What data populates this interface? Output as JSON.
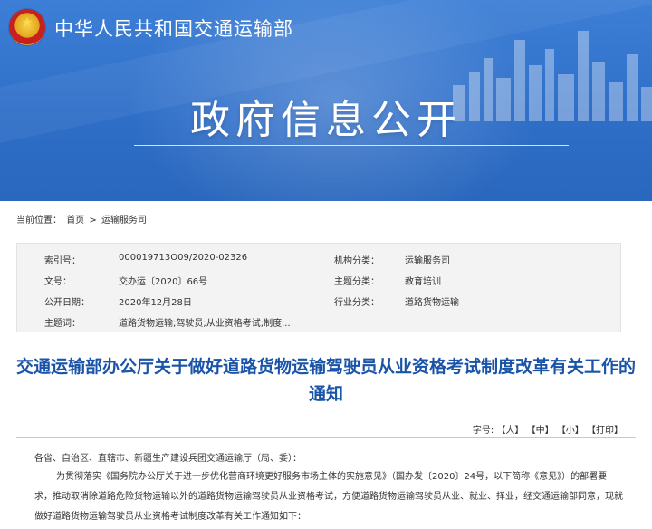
{
  "header": {
    "ministry_name": "中华人民共和国交通运输部",
    "section_title": "政府信息公开"
  },
  "breadcrumb": {
    "label": "当前位置：",
    "home": "首页",
    "separator": ">",
    "current": "运输服务司"
  },
  "info": {
    "rows": [
      {
        "label1": "索引号：",
        "value1": "000019713O09/2020-02326",
        "label2": "机构分类：",
        "value2": "运输服务司"
      },
      {
        "label1": "文号：",
        "value1": "交办运〔2020〕66号",
        "label2": "主题分类：",
        "value2": "教育培训"
      },
      {
        "label1": "公开日期：",
        "value1": "2020年12月28日",
        "label2": "行业分类：",
        "value2": "道路货物运输"
      },
      {
        "label1": "主题词：",
        "value1": "道路货物运输;驾驶员;从业资格考试;制度...",
        "label2": "",
        "value2": ""
      }
    ]
  },
  "article": {
    "title": "交通运输部办公厅关于做好道路货物运输驾驶员从业资格考试制度改革有关工作的通知",
    "font_size_label": "字号:",
    "font_large": "【大】",
    "font_medium": "【中】",
    "font_small": "【小】",
    "print": "【打印】",
    "para1": "各省、自治区、直辖市、新疆生产建设兵团交通运输厅（局、委）：",
    "para2": "为贯彻落实《国务院办公厅关于进一步优化营商环境更好服务市场主体的实施意见》（国办发〔2020〕24号，以下简称《意见》）的部署要求，推动取消除道路危险货物运输以外的道路货物运输驾驶员从业资格考试，方便道路货物运输驾驶员从业、就业、择业，经交通运输部同意，现就做好道路货物运输驾驶员从业资格考试制度改革有关工作通知如下："
  },
  "colors": {
    "banner_blue": "#2f6fc9",
    "title_blue": "#1a54a8",
    "table_bg": "#f3f3f3"
  }
}
